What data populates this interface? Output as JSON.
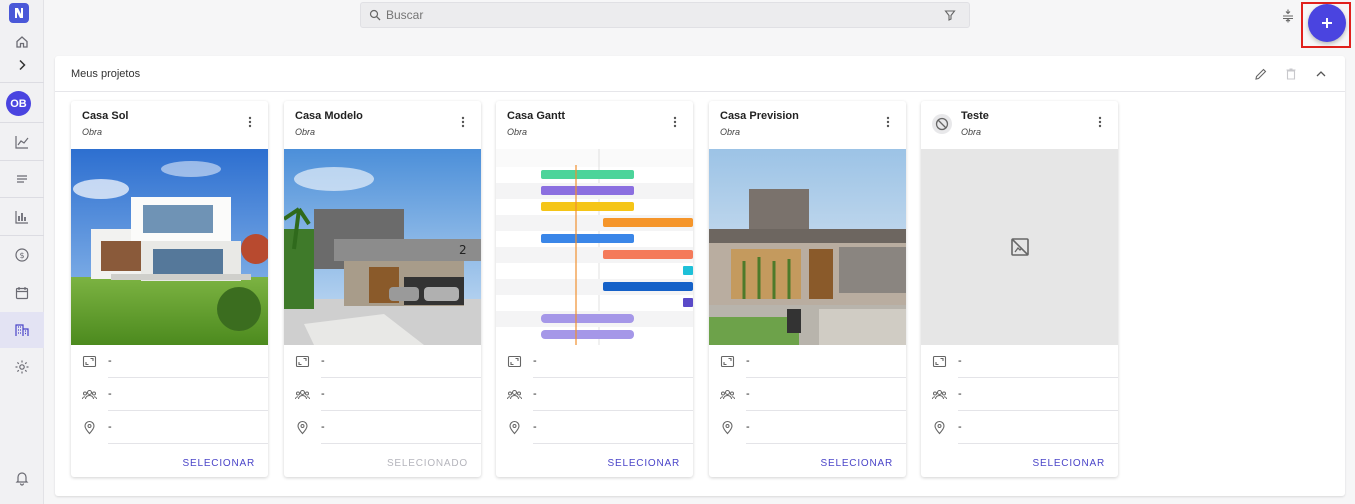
{
  "search": {
    "placeholder": "Buscar"
  },
  "sidebar": {
    "avatar_initials": "OB",
    "items": [
      "home-icon",
      "chevron-right-icon",
      "trend-icon",
      "list-icon",
      "bar-chart-icon",
      "dollar-icon",
      "calendar-icon",
      "buildings-icon",
      "gear-icon",
      "bell-icon"
    ]
  },
  "panel": {
    "title": "Meus projetos"
  },
  "cards": [
    {
      "title": "Casa Sol",
      "subtitle": "Obra",
      "area": "-",
      "team": "-",
      "location": "-",
      "action": "SELECIONAR",
      "selected": false
    },
    {
      "title": "Casa Modelo",
      "subtitle": "Obra",
      "area": "-",
      "team": "-",
      "location": "-",
      "action": "SELECIONADO",
      "selected": true
    },
    {
      "title": "Casa Gantt",
      "subtitle": "Obra",
      "area": "-",
      "team": "-",
      "location": "-",
      "action": "SELECIONAR",
      "selected": false
    },
    {
      "title": "Casa Prevision",
      "subtitle": "Obra",
      "area": "-",
      "team": "-",
      "location": "-",
      "action": "SELECIONAR",
      "selected": false
    },
    {
      "title": "Teste",
      "subtitle": "Obra",
      "area": "-",
      "team": "-",
      "location": "-",
      "action": "SELECIONAR",
      "selected": false
    }
  ],
  "colors": {
    "accent": "#4a44e0",
    "highlight": "#e0201c"
  }
}
